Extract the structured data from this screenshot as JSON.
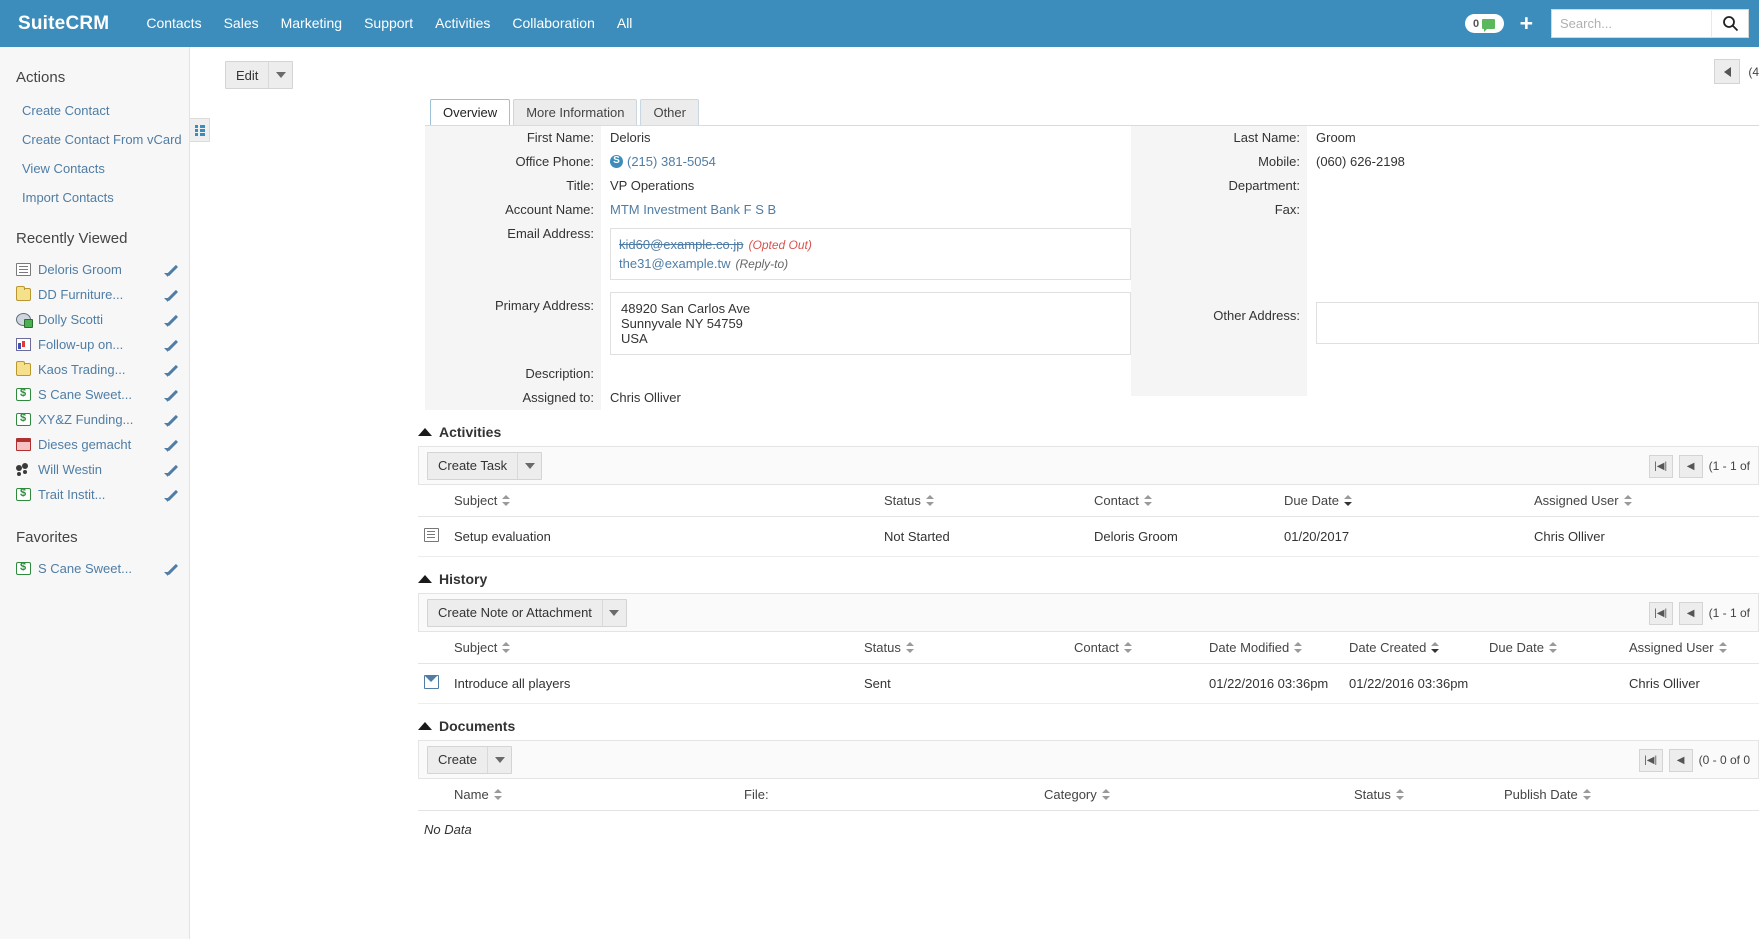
{
  "navbar": {
    "brand": "SuiteCRM",
    "items": [
      {
        "label": "Contacts"
      },
      {
        "label": "Sales"
      },
      {
        "label": "Marketing"
      },
      {
        "label": "Support"
      },
      {
        "label": "Activities"
      },
      {
        "label": "Collaboration"
      },
      {
        "label": "All"
      }
    ],
    "notification_count": "0",
    "plus_label": "+",
    "search_placeholder": "Search...",
    "search_value": "",
    "brand_color": "#3C8DBC"
  },
  "sidebar": {
    "actions_heading": "Actions",
    "actions": [
      {
        "label": "Create Contact"
      },
      {
        "label": "Create Contact From vCard"
      },
      {
        "label": "View Contacts"
      },
      {
        "label": "Import Contacts"
      }
    ],
    "recently_viewed_heading": "Recently Viewed",
    "recently_viewed": [
      {
        "label": "Deloris Groom",
        "icon": "contact-icon"
      },
      {
        "label": "DD Furniture...",
        "icon": "folder-icon"
      },
      {
        "label": "Dolly Scotti",
        "icon": "lead-icon"
      },
      {
        "label": "Follow-up on...",
        "icon": "chart-icon"
      },
      {
        "label": "Kaos Trading...",
        "icon": "folder-icon"
      },
      {
        "label": "S Cane Sweet...",
        "icon": "money-icon"
      },
      {
        "label": "XY&Z Funding...",
        "icon": "money-icon"
      },
      {
        "label": "Dieses gemacht",
        "icon": "calendar-icon"
      },
      {
        "label": "Will Westin",
        "icon": "users-icon"
      },
      {
        "label": "Trait Instit...",
        "icon": "money-icon"
      }
    ],
    "favorites_heading": "Favorites",
    "favorites": [
      {
        "label": "S Cane Sweet...",
        "icon": "money-icon"
      }
    ]
  },
  "toolbar": {
    "edit_label": "Edit",
    "record_count": "(4"
  },
  "tabs": [
    {
      "label": "Overview",
      "active": true
    },
    {
      "label": "More Information",
      "active": false
    },
    {
      "label": "Other",
      "active": false
    }
  ],
  "detail": {
    "left": {
      "first_name_label": "First Name:",
      "first_name_value": "Deloris",
      "office_phone_label": "Office Phone:",
      "office_phone_value": "(215) 381-5054",
      "title_label": "Title:",
      "title_value": "VP Operations",
      "account_name_label": "Account Name:",
      "account_name_value": "MTM Investment Bank F S B",
      "email_label": "Email Address:",
      "emails": [
        {
          "address": "kid60@example.co.jp",
          "flag": "(Opted Out)",
          "opted_out": true
        },
        {
          "address": "the31@example.tw",
          "flag": "(Reply-to)",
          "opted_out": false
        }
      ],
      "primary_address_label": "Primary Address:",
      "primary_address_lines": [
        "48920 San Carlos Ave",
        "Sunnyvale NY  54759",
        "USA"
      ],
      "description_label": "Description:",
      "description_value": "",
      "assigned_to_label": "Assigned to:",
      "assigned_to_value": "Chris Olliver"
    },
    "right": {
      "last_name_label": "Last Name:",
      "last_name_value": "Groom",
      "mobile_label": "Mobile:",
      "mobile_value": "(060) 626-2198",
      "department_label": "Department:",
      "department_value": "",
      "fax_label": "Fax:",
      "fax_value": "",
      "other_address_label": "Other Address:",
      "other_address_value": ""
    }
  },
  "activities": {
    "title": "Activities",
    "create_button": "Create Task",
    "pager_text": "(1 - 1 of ",
    "columns": [
      "Subject",
      "Status",
      "Contact",
      "Due Date",
      "Assigned User"
    ],
    "rows": [
      {
        "icon": "task-icon",
        "subject": "Setup evaluation",
        "status": "Not Started",
        "contact": "Deloris Groom",
        "due_date": "01/20/2017",
        "assigned_user": "Chris Olliver"
      }
    ]
  },
  "history": {
    "title": "History",
    "create_button": "Create Note or Attachment",
    "pager_text": "(1 - 1 of ",
    "columns": [
      "Subject",
      "Status",
      "Contact",
      "Date Modified",
      "Date Created",
      "Due Date",
      "Assigned User"
    ],
    "rows": [
      {
        "icon": "mail-icon",
        "subject": "Introduce all players",
        "status": "Sent",
        "contact": "",
        "date_modified": "01/22/2016 03:36pm",
        "date_created": "01/22/2016 03:36pm",
        "due_date": "",
        "assigned_user": "Chris Olliver"
      }
    ]
  },
  "documents": {
    "title": "Documents",
    "create_button": "Create",
    "pager_text": "(0 - 0 of 0",
    "columns": [
      "Name",
      "File:",
      "Category",
      "Status",
      "Publish Date"
    ],
    "empty_text": "No Data"
  }
}
